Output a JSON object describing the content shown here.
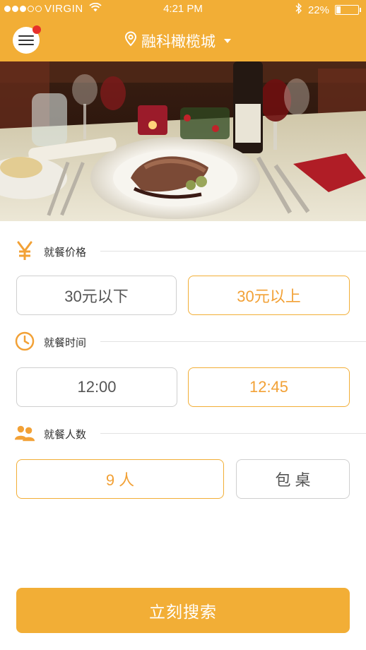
{
  "status_bar": {
    "carrier": "VIRGIN",
    "time": "4:21 PM",
    "battery": "22%",
    "battery_level": 0.22
  },
  "header": {
    "city": "融科橄榄城",
    "menu_icon": "hamburger-menu-icon",
    "location_icon": "map-pin-icon",
    "accent_color": "#F2AE36"
  },
  "hero": {
    "description_icon": "dining-photo"
  },
  "sections": {
    "price": {
      "label": "就餐价格",
      "icon": "yen-icon",
      "options": [
        "30元以下",
        "30元以上"
      ],
      "selected": "30元以上"
    },
    "time": {
      "label": "就餐时间",
      "icon": "clock-icon",
      "options": [
        "12:00",
        "12:45"
      ],
      "selected": "12:45"
    },
    "people": {
      "label": "就餐人数",
      "icon": "people-icon",
      "options": [
        "9 人",
        "包 桌"
      ],
      "selected": "9 人"
    }
  },
  "search_button": "立刻搜索"
}
